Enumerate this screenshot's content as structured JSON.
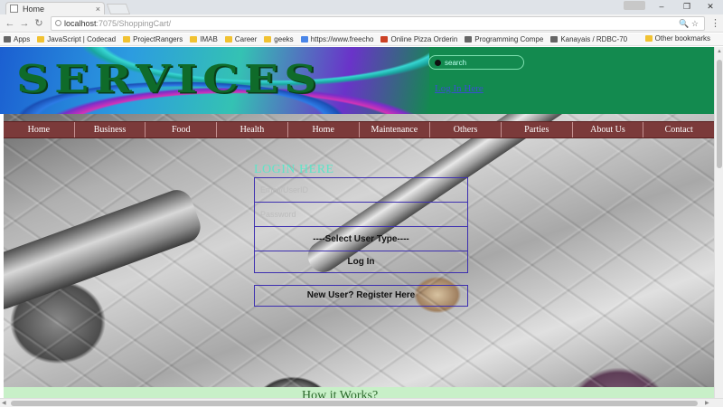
{
  "browser": {
    "tab_title": "Home",
    "tab_close": "×",
    "url_host": "localhost",
    "url_path": ":7075/ShoppingCart/",
    "window_controls": [
      "–",
      "❐",
      "✕"
    ],
    "bookmarks": [
      {
        "label": "Apps",
        "icon": "apps-icon"
      },
      {
        "label": "JavaScript | Codecad",
        "icon": "folder-icon"
      },
      {
        "label": "ProjectRangers",
        "icon": "folder-icon"
      },
      {
        "label": "IMAB",
        "icon": "folder-icon"
      },
      {
        "label": "Career",
        "icon": "folder-icon"
      },
      {
        "label": "geeks",
        "icon": "folder-icon"
      },
      {
        "label": "https://www.freecho",
        "icon": "globe-icon"
      },
      {
        "label": "Online Pizza Orderin",
        "icon": "pin-icon"
      },
      {
        "label": "Programming Compe",
        "icon": "code-icon"
      },
      {
        "label": "Kanayais / RDBC-70",
        "icon": "github-icon"
      }
    ],
    "other_bookmarks": "Other bookmarks"
  },
  "header": {
    "logo_text": "SERVICES",
    "search_placeholder": "search",
    "login_link": "Log In Here"
  },
  "nav": {
    "items": [
      "Home",
      "Business",
      "Food",
      "Health",
      "Home",
      "Maintenance",
      "Others",
      "Parties",
      "About Us",
      "Contact"
    ]
  },
  "login": {
    "title": "LOGIN HERE",
    "username_placeholder": "Email/UserID",
    "password_placeholder": "Password",
    "user_type_select": "----Select User Type----",
    "submit_label": "Log In",
    "register_label": "New User? Register Here"
  },
  "footer_strip": {
    "heading": "How it Works?"
  },
  "colors": {
    "header_bg": "#138a4f",
    "nav_bg": "#7b3a3a",
    "form_border": "#3d2fb0",
    "login_title": "#5ee5c8",
    "link": "#3a4fd1"
  }
}
